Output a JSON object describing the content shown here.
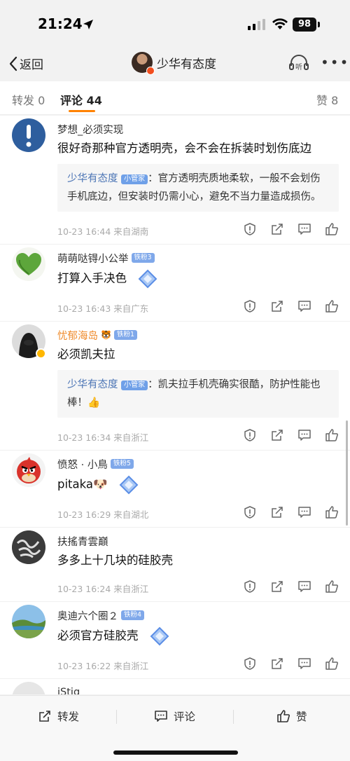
{
  "status": {
    "time": "21:24",
    "battery": "98"
  },
  "nav": {
    "back_label": "返回",
    "title": "少华有态度",
    "listen_label": "听"
  },
  "tabs": [
    {
      "label": "转发 0"
    },
    {
      "label": "评论 44"
    },
    {
      "label": "赞 8"
    }
  ],
  "comments": [
    {
      "user": "梦想_必须实现",
      "text": "很好奇那种官方透明壳，会不会在拆装时划伤底边",
      "reply": {
        "name": "少华有态度",
        "tag": "小管家",
        "text": "：官方透明壳质地柔软，一般不会划伤手机底边，但安装时仍需小心，避免不当力量造成损伤。"
      },
      "meta": "10-23 16:44  来自湖南"
    },
    {
      "user": "萌萌哒锝小公举",
      "badge": "铁粉3",
      "text": "打算入手决色",
      "meta": "10-23 16:43  来自广东"
    },
    {
      "user": "忧郁海岛",
      "badge": "铁粉1",
      "text": "必须凯夫拉",
      "reply": {
        "name": "少华有态度",
        "tag": "小管家",
        "text": "：凯夫拉手机壳确实很酷，防护性能也棒！👍"
      },
      "meta": "10-23 16:34  来自浙江"
    },
    {
      "user": "愤怒 · 小鳥",
      "badge": "铁粉5",
      "text": "pitaka🐶",
      "meta": "10-23 16:29  来自湖北"
    },
    {
      "user": "扶搖青雲巔",
      "text": "多多上十几块的硅胶壳",
      "meta": "10-23 16:24  来自浙江"
    },
    {
      "user": "奥迪六个圈２",
      "badge": "铁粉4",
      "text": "必须官方硅胶壳",
      "meta": "10-23 16:22  来自浙江"
    },
    {
      "user": "iStig"
    }
  ],
  "bottom": {
    "repost": "转发",
    "comment": "评论",
    "like": "赞"
  },
  "colors": {
    "accent": "#ff8200",
    "link": "#4c75b5"
  }
}
